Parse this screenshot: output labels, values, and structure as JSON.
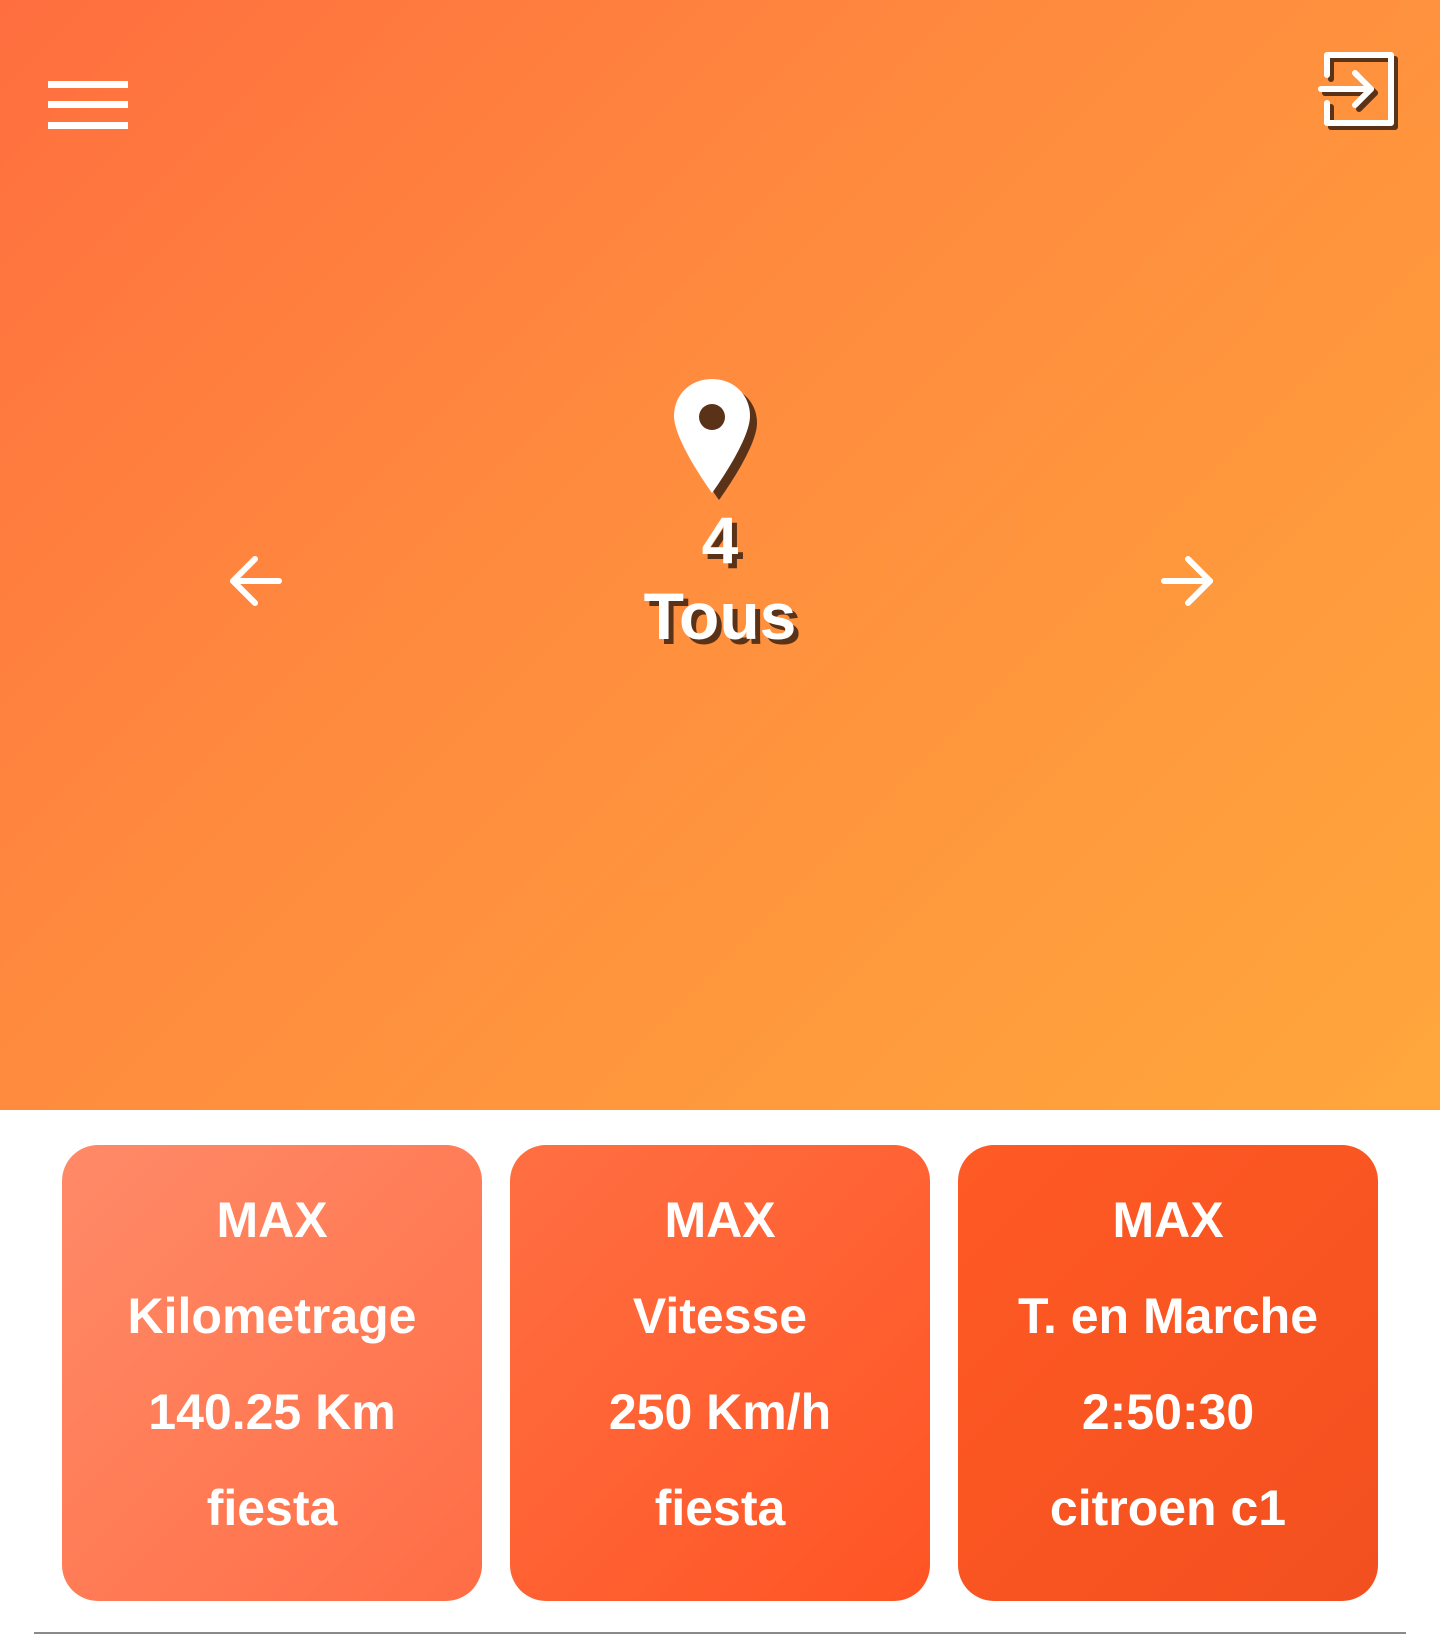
{
  "header": {
    "menu_icon": "hamburger-menu-icon",
    "logout_icon": "logout-icon"
  },
  "selector": {
    "pin_icon": "location-pin-icon",
    "count": "4",
    "label": "Tous",
    "prev_icon": "arrow-left-icon",
    "next_icon": "arrow-right-icon"
  },
  "stats": [
    {
      "title": "MAX",
      "metric": "Kilometrage",
      "value": "140.25 Km",
      "vehicle": "fiesta"
    },
    {
      "title": "MAX",
      "metric": "Vitesse",
      "value": "250 Km/h",
      "vehicle": "fiesta"
    },
    {
      "title": "MAX",
      "metric": "T. en Marche",
      "value": "2:50:30",
      "vehicle": "citroen c1"
    }
  ],
  "colors": {
    "hero_gradient_start": "#ff6e3f",
    "hero_gradient_end": "#ffa73c",
    "card_1": "#ff7b55",
    "card_2": "#ff5f30",
    "card_3": "#f85421",
    "text_shadow": "#5a3218"
  }
}
